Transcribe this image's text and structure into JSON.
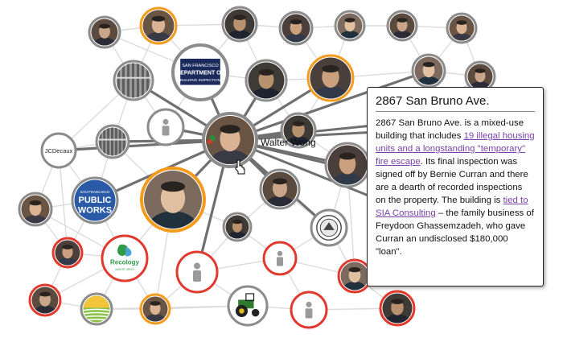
{
  "colors": {
    "edge_light": "#dcdcdc",
    "edge_dark": "#707070",
    "ring_gray": "#8c8c8c",
    "ring_orange": "#f29b1d",
    "ring_red": "#e03a2f",
    "placeholder": "#9a9a9a",
    "link": "#7a3fa8"
  },
  "focus_node": {
    "label": "Walter Wong"
  },
  "logos": {
    "jcdecaux": "JCDecaux",
    "public_works": {
      "line1": "SAN FRANCISCO",
      "line2": "PUBLIC",
      "line3": "WORKS"
    },
    "recology": {
      "name": "Recology",
      "sub": "WASTE ZERO"
    },
    "dbi": {
      "line1": "SAN FRANCISCO",
      "line2": "DEPARTMENT OF",
      "line3": "BUILDING INSPECTION"
    }
  },
  "tooltip": {
    "title": "2867 San Bruno Ave.",
    "text_1": "2867 San Bruno Ave. is a mixed-use building that includes ",
    "link_1": "19 illegal housing units and a longstanding \"temporary\" fire escape",
    "text_2": ". Its final inspection was signed off by Bernie Curran and there are a dearth of recorded inspections on the property. The building is ",
    "link_2": "tied to SIA Consulting",
    "text_3": " – the family business of Freydoon Ghassemzadeh, who gave Curran an undisclosed $180,000 \"loan\"."
  }
}
